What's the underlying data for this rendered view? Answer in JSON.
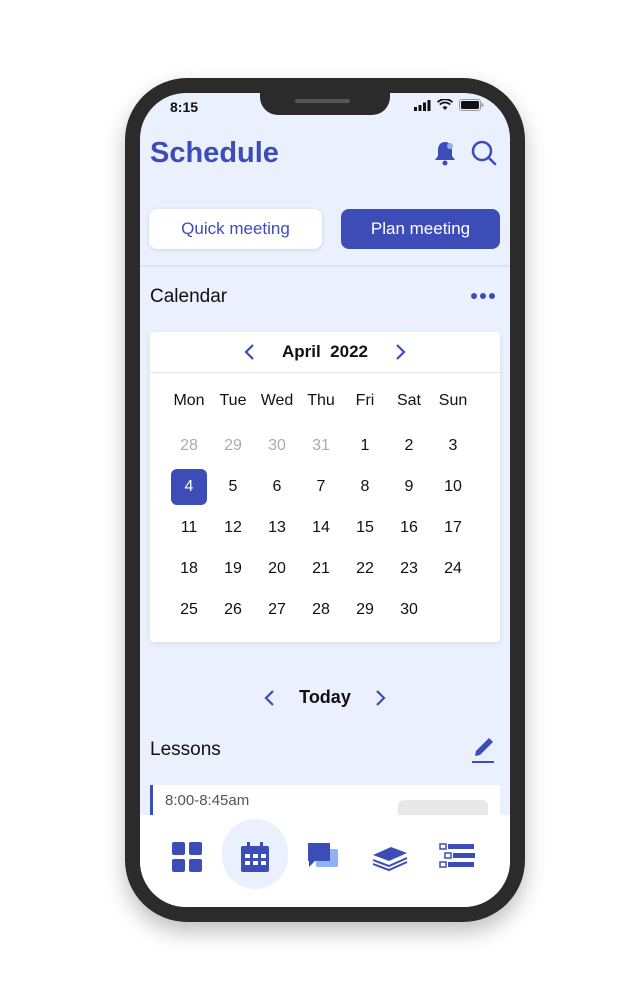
{
  "status_bar": {
    "time": "8:15"
  },
  "header": {
    "title": "Schedule",
    "icons": [
      "bell-icon",
      "search-icon"
    ]
  },
  "actions": {
    "quick_meeting": "Quick meeting",
    "plan_meeting": "Plan meeting"
  },
  "calendar_section": {
    "label": "Calendar",
    "menu_icon": "more-horizontal-icon"
  },
  "calendar": {
    "month": "April",
    "year": "2022",
    "weekdays": [
      "Mon",
      "Tue",
      "Wed",
      "Thu",
      "Fri",
      "Sat",
      "Sun"
    ],
    "weeks": [
      [
        "28",
        "29",
        "30",
        "31",
        "1",
        "2",
        "3"
      ],
      [
        "4",
        "5",
        "6",
        "7",
        "8",
        "9",
        "10"
      ],
      [
        "11",
        "12",
        "13",
        "14",
        "15",
        "16",
        "17"
      ],
      [
        "18",
        "19",
        "20",
        "21",
        "22",
        "23",
        "24"
      ],
      [
        "25",
        "26",
        "27",
        "28",
        "29",
        "30",
        ""
      ]
    ],
    "other_month_first_row_count": 4,
    "selected": "4"
  },
  "day_nav": {
    "label": "Today"
  },
  "lessons_section": {
    "label": "Lessons",
    "edit_icon": "pencil-icon"
  },
  "lessons": [
    {
      "time": "8:00-8:45am"
    }
  ],
  "tabs": [
    "dashboard-icon",
    "calendar-icon",
    "chat-icon",
    "books-icon",
    "tasks-icon"
  ],
  "colors": {
    "accent": "#3d4db7",
    "background": "#eaf0fd"
  }
}
